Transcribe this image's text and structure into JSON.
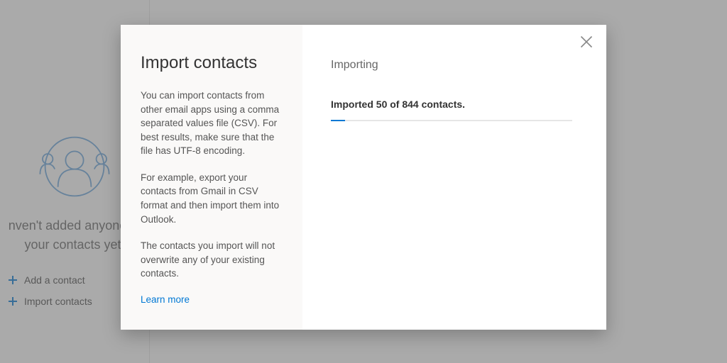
{
  "background": {
    "empty_line1": "nven't added anyone to",
    "empty_line2": "your contacts yet.",
    "add_contact_label": "Add a contact",
    "import_contacts_label": "Import contacts"
  },
  "modal": {
    "title": "Import contacts",
    "desc1": "You can import contacts from other email apps using a comma separated values file (CSV). For best results, make sure that the file has UTF-8 encoding.",
    "desc2": "For example, export your contacts from Gmail in CSV format and then import them into Outlook.",
    "desc3": "The contacts you import will not overwrite any of your existing contacts.",
    "learn_more": "Learn more",
    "right_heading": "Importing",
    "imported": 50,
    "total": 844,
    "status_template": "Imported {imported} of {total} contacts."
  },
  "colors": {
    "accent": "#0078d4"
  }
}
